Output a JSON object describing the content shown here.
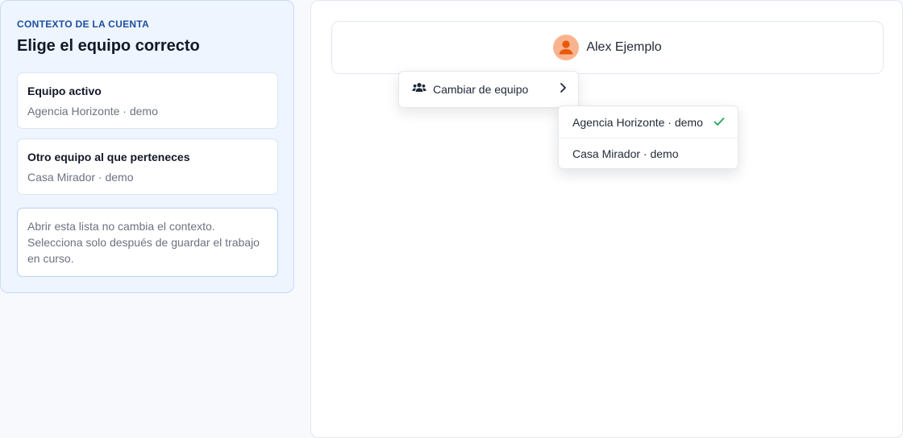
{
  "sidebar": {
    "eyebrow": "CONTEXTO DE LA CUENTA",
    "title": "Elige el equipo correcto",
    "active_team": {
      "label": "Equipo activo",
      "value": "Agencia Horizonte · demo"
    },
    "other_team": {
      "label": "Otro equipo al que perteneces",
      "value": "Casa Mirador · demo"
    },
    "note": "Abrir esta lista no cambia el contexto. Selecciona solo después de guardar el trabajo en curso."
  },
  "header": {
    "user_name": "Alex Ejemplo",
    "avatar_icon": "user-icon"
  },
  "menu": {
    "switch_team_label": "Cambiar de equipo",
    "icon": "users-icon",
    "chevron": "chevron-right-icon"
  },
  "team_options": [
    {
      "label": "Agencia Horizonte · demo",
      "selected": true
    },
    {
      "label": "Casa Mirador · demo",
      "selected": false
    }
  ],
  "colors": {
    "accent": "#1d4ea0",
    "avatar_bg": "#f9b48f",
    "avatar_fg": "#e8590c",
    "check": "#22a75a"
  }
}
